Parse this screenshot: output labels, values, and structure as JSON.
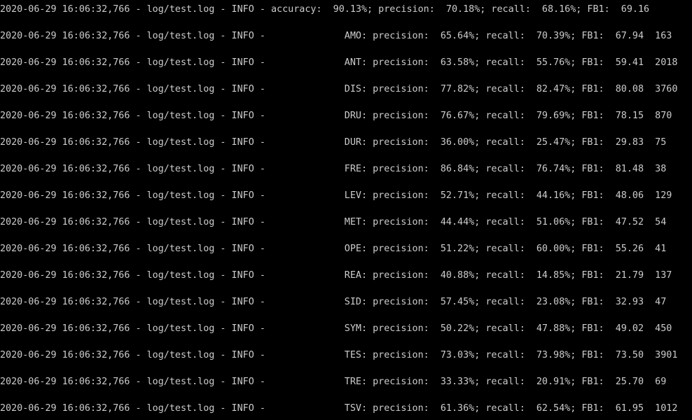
{
  "console": {
    "lines": [
      "2020-06-29 16:06:32,766 - log/test.log - INFO - accuracy:  90.13%; precision:  70.18%; recall:  68.16%; FB1:  69.16",
      "2020-06-29 16:06:32,766 - log/test.log - INFO -              AMO: precision:  65.64%; recall:  70.39%; FB1:  67.94  163",
      "2020-06-29 16:06:32,766 - log/test.log - INFO -              ANT: precision:  63.58%; recall:  55.76%; FB1:  59.41  2018",
      "2020-06-29 16:06:32,766 - log/test.log - INFO -              DIS: precision:  77.82%; recall:  82.47%; FB1:  80.08  3760",
      "2020-06-29 16:06:32,766 - log/test.log - INFO -              DRU: precision:  76.67%; recall:  79.69%; FB1:  78.15  870",
      "2020-06-29 16:06:32,766 - log/test.log - INFO -              DUR: precision:  36.00%; recall:  25.47%; FB1:  29.83  75",
      "2020-06-29 16:06:32,766 - log/test.log - INFO -              FRE: precision:  86.84%; recall:  76.74%; FB1:  81.48  38",
      "2020-06-29 16:06:32,766 - log/test.log - INFO -              LEV: precision:  52.71%; recall:  44.16%; FB1:  48.06  129",
      "2020-06-29 16:06:32,766 - log/test.log - INFO -              MET: precision:  44.44%; recall:  51.06%; FB1:  47.52  54",
      "2020-06-29 16:06:32,766 - log/test.log - INFO -              OPE: precision:  51.22%; recall:  60.00%; FB1:  55.26  41",
      "2020-06-29 16:06:32,766 - log/test.log - INFO -              REA: precision:  40.88%; recall:  14.85%; FB1:  21.79  137",
      "2020-06-29 16:06:32,766 - log/test.log - INFO -              SID: precision:  57.45%; recall:  23.08%; FB1:  32.93  47",
      "2020-06-29 16:06:32,766 - log/test.log - INFO -              SYM: precision:  50.22%; recall:  47.88%; FB1:  49.02  450",
      "2020-06-29 16:06:32,766 - log/test.log - INFO -              TES: precision:  73.03%; recall:  73.98%; FB1:  73.50  3901",
      "2020-06-29 16:06:32,766 - log/test.log - INFO -              TRE: precision:  33.33%; recall:  20.91%; FB1:  25.70  69",
      "2020-06-29 16:06:32,766 - log/test.log - INFO -              TSV: precision:  61.36%; recall:  62.54%; FB1:  61.95  1012"
    ]
  }
}
